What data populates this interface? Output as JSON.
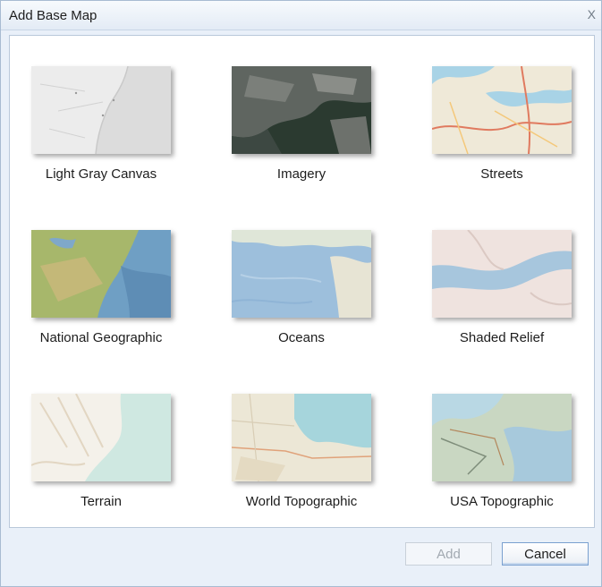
{
  "dialog": {
    "title": "Add Base Map",
    "close_label": "X"
  },
  "basemaps": [
    {
      "label": "Light Gray Canvas"
    },
    {
      "label": "Imagery"
    },
    {
      "label": "Streets"
    },
    {
      "label": "National Geographic"
    },
    {
      "label": "Oceans"
    },
    {
      "label": "Shaded Relief"
    },
    {
      "label": "Terrain"
    },
    {
      "label": "World Topographic"
    },
    {
      "label": "USA Topographic"
    }
  ],
  "footer": {
    "add_label": "Add",
    "cancel_label": "Cancel"
  }
}
